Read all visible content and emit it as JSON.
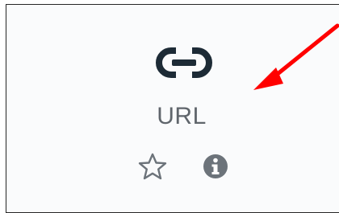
{
  "activity": {
    "label": "URL",
    "icon": "link-icon"
  },
  "actions": {
    "favorite_icon": "star-icon",
    "info_icon": "info-icon"
  },
  "annotation": {
    "icon": "arrow-icon",
    "color": "#ff0000"
  },
  "colors": {
    "icon": "#1d2b36",
    "label": "#5f656b",
    "action_icon": "#6c737a",
    "frame_border": "#262626",
    "card_background": "#fafbfc"
  }
}
